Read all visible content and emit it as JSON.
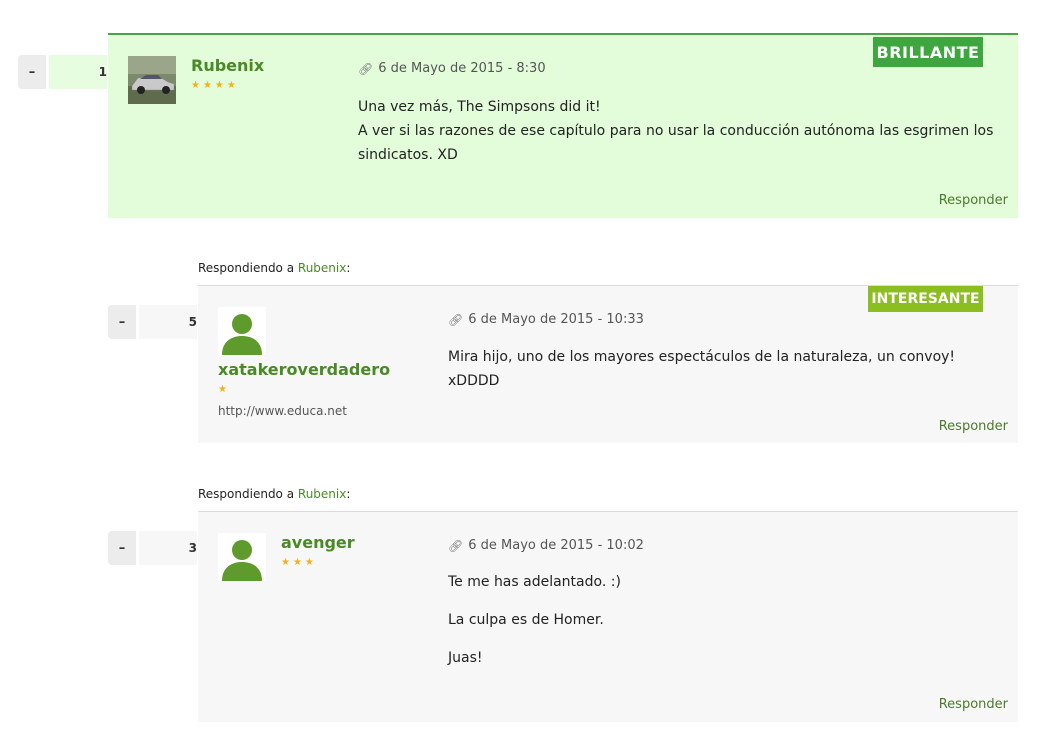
{
  "comments": [
    {
      "vote_minus": "–",
      "vote_count": "1",
      "badge": "BRILLANTE",
      "author": "Rubenix",
      "stars": "★★★★",
      "date": "6 de Mayo de 2015 - 8:30",
      "lines": [
        "Una vez más, The Simpsons did it!",
        "A ver si las razones de ese capítulo para no usar la conducción autónoma las esgrimen los sindicatos. XD"
      ],
      "reply_label": "Responder"
    },
    {
      "replying_prefix": "Respondiendo a",
      "replying_to": "Rubenix",
      "replying_suffix": ":",
      "vote_minus": "–",
      "vote_count": "5",
      "badge": "INTERESANTE",
      "author": "xatakeroverdadero",
      "stars": "★",
      "website": "http://www.educa.net",
      "lines": [
        "Mira hijo, uno de los mayores espectáculos de la naturaleza, un convoy! xDDDD"
      ],
      "date": "6 de Mayo de 2015 - 10:33",
      "reply_label": "Responder"
    },
    {
      "replying_prefix": "Respondiendo a",
      "replying_to": "Rubenix",
      "replying_suffix": ":",
      "vote_minus": "–",
      "vote_count": "3",
      "author": "avenger",
      "stars": "★★★",
      "date": "6 de Mayo de 2015 - 10:02",
      "paragraphs": [
        "Te me has adelantado. :)",
        "La culpa es de Homer.",
        "Juas!"
      ],
      "reply_label": "Responder"
    }
  ],
  "icons": {
    "link": "link-icon",
    "avatar_default": "user-silhouette-icon",
    "avatar_car": "car-photo-avatar"
  },
  "colors": {
    "featured_bg": "#e3fddb",
    "featured_border": "#47a447",
    "reply_bg": "#f7f7f7",
    "badge_brillante": "#3ea63e",
    "badge_interesante": "#8bbe1f",
    "author": "#4a8a26",
    "stars": "#f2b21b"
  }
}
